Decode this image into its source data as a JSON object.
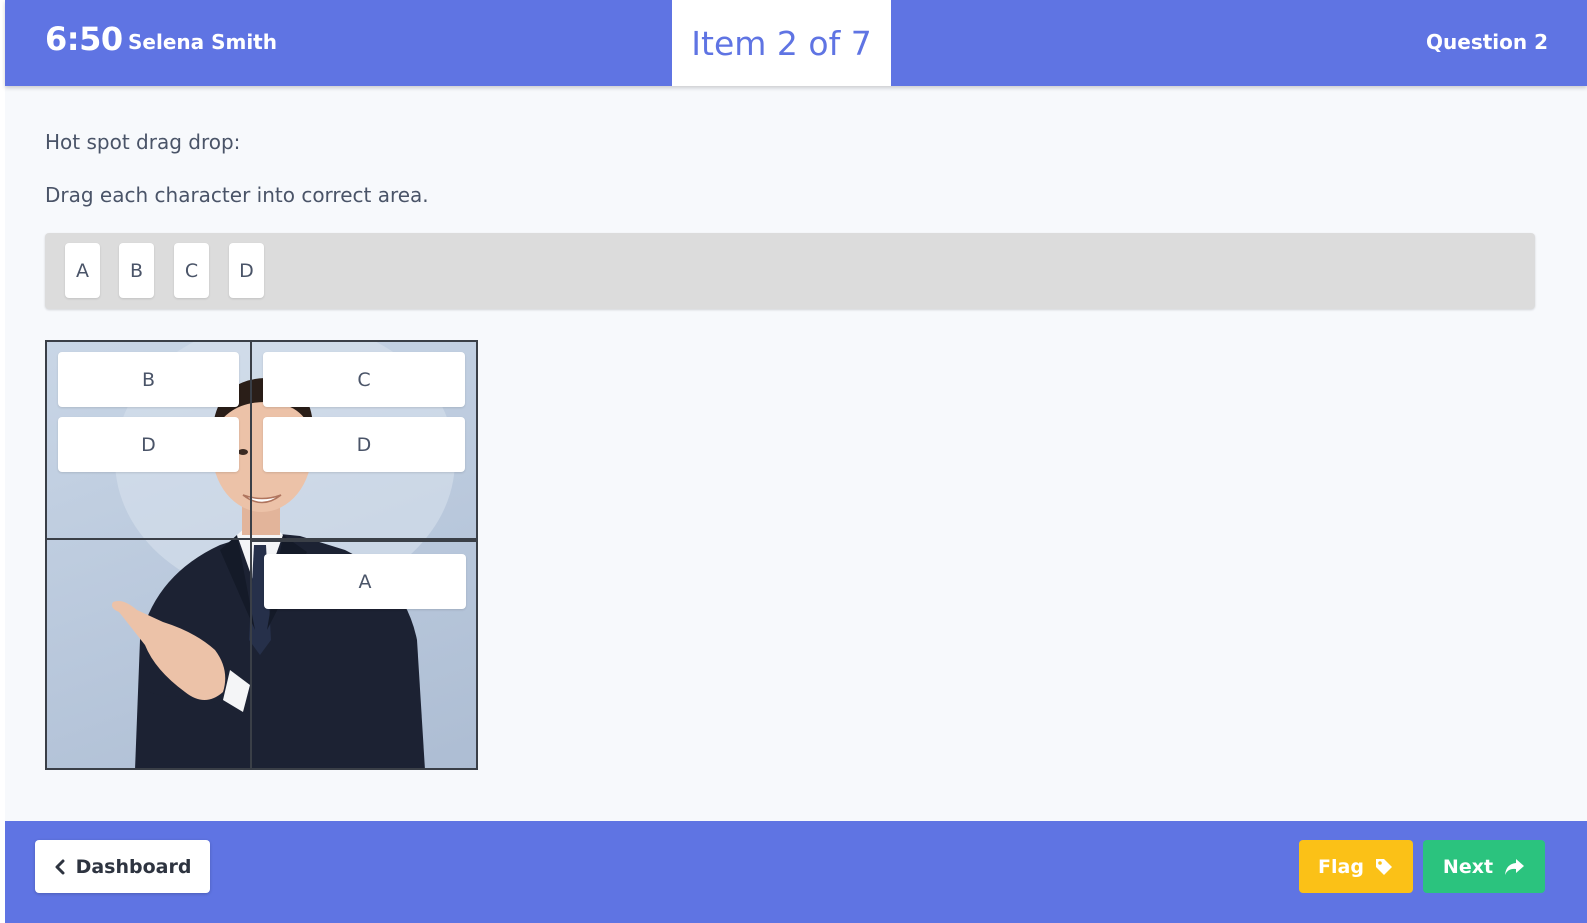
{
  "header": {
    "timer": "6:50",
    "user_name": "Selena Smith",
    "item_counter": "Item 2 of 7",
    "question_label": "Question 2"
  },
  "question": {
    "prompt": "Hot spot drag drop:",
    "instruction": "Drag each character into correct area."
  },
  "tray": {
    "chips": [
      "A",
      "B",
      "C",
      "D"
    ]
  },
  "hotspot": {
    "zones": {
      "top_left": [
        "B",
        "D"
      ],
      "top_right": [
        "C",
        "D"
      ],
      "bottom_left": [],
      "bottom_right": [
        "A"
      ]
    }
  },
  "footer": {
    "dashboard_label": "Dashboard",
    "flag_label": "Flag",
    "next_label": "Next"
  },
  "colors": {
    "brand": "#5f74e3",
    "flag": "#fbc117",
    "next": "#2bc37e",
    "tray": "#dcdcdc"
  },
  "icons": {
    "dashboard": "chevron-left-icon",
    "flag": "tag-icon",
    "next": "share-arrow-icon"
  }
}
